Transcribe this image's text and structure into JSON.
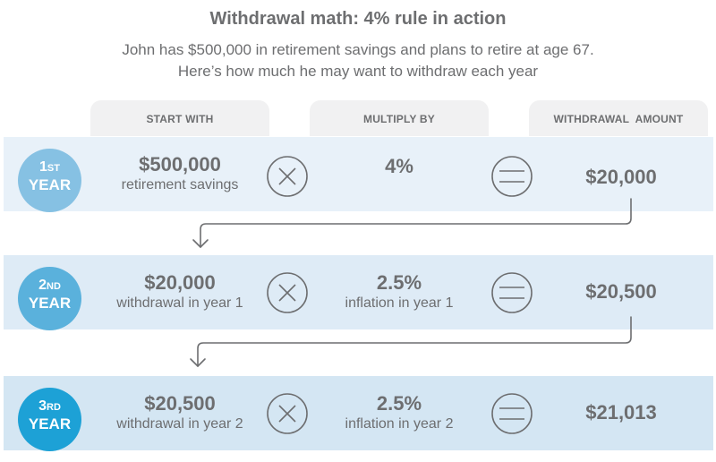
{
  "title": "Withdrawal math: 4% rule in action",
  "subtitle_line1": "John has $500,000 in retirement savings and plans to retire at age 67.",
  "subtitle_line2": "Here’s how much he may want to withdraw each year",
  "headers": {
    "start_with": "START WITH",
    "multiply_by": "MULTIPLY BY",
    "withdrawal_amount": "WITHDRAWAL  AMOUNT"
  },
  "colors": {
    "row_bg": [
      "#e8f1f9",
      "#deebf6",
      "#d4e6f3"
    ],
    "badge": [
      "#86c1e3",
      "#5ab1dc",
      "#1da1d6"
    ],
    "text": "#6d6e70"
  },
  "rows": [
    {
      "ordinal_num": "1",
      "ordinal_suffix": "ST",
      "year_label": "YEAR",
      "start_value": "$500,000",
      "start_desc": "retirement savings",
      "multiply_value": "4%",
      "multiply_desc": "",
      "operator1": "multiply-icon",
      "operator2": "equals-icon",
      "result": "$20,000"
    },
    {
      "ordinal_num": "2",
      "ordinal_suffix": "ND",
      "year_label": "YEAR",
      "start_value": "$20,000",
      "start_desc": "withdrawal in year 1",
      "multiply_value": "2.5%",
      "multiply_desc": "inflation in year 1",
      "operator1": "multiply-icon",
      "operator2": "equals-icon",
      "result": "$20,500"
    },
    {
      "ordinal_num": "3",
      "ordinal_suffix": "RD",
      "year_label": "YEAR",
      "start_value": "$20,500",
      "start_desc": "withdrawal in year 2",
      "multiply_value": "2.5%",
      "multiply_desc": "inflation in year 2",
      "operator1": "multiply-icon",
      "operator2": "equals-icon",
      "result": "$21,013"
    }
  ]
}
